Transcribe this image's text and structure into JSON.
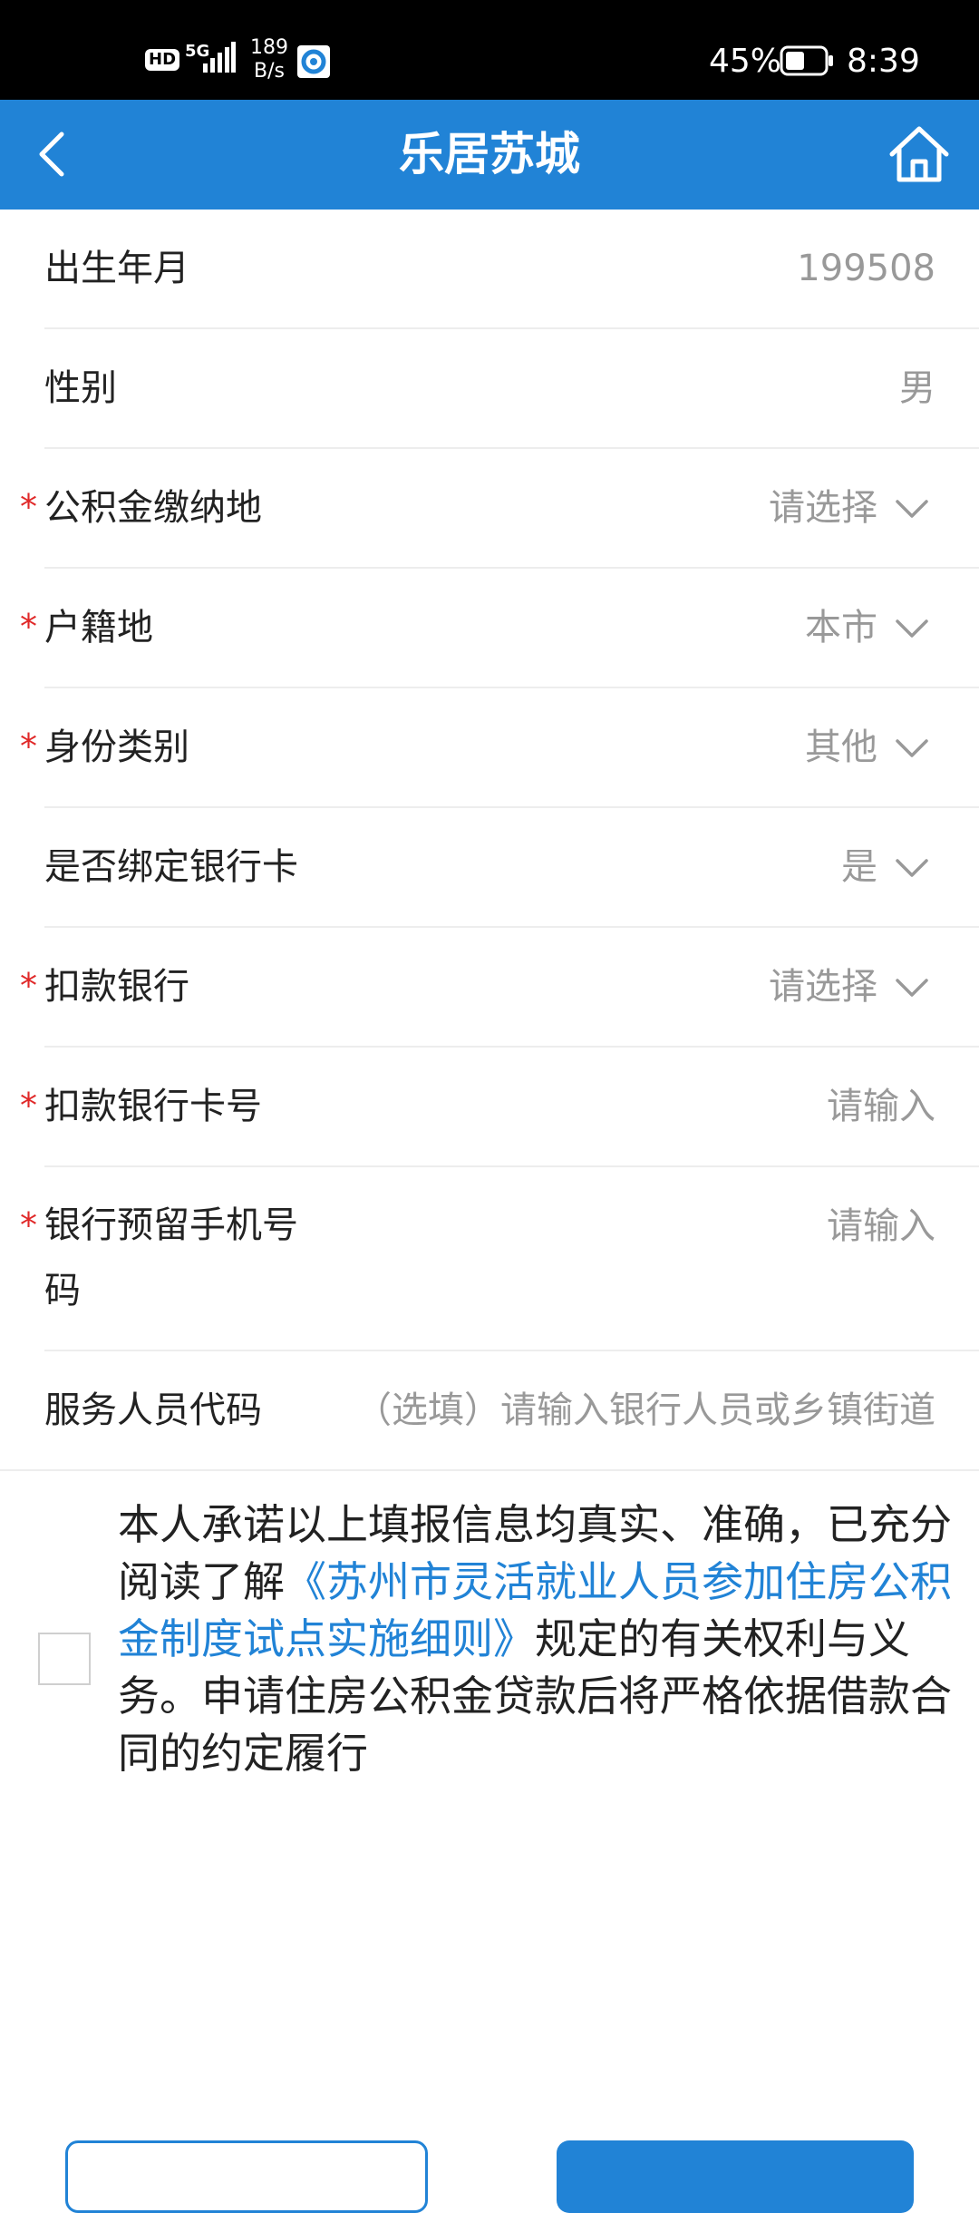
{
  "status_bar": {
    "hd": "HD",
    "network": "5G",
    "rate_value": "189",
    "rate_unit": "B/s",
    "battery_pct": "45%",
    "time": "8:39"
  },
  "app_bar": {
    "title": "乐居苏城",
    "back_icon": "chevron-left-icon",
    "home_icon": "home-icon"
  },
  "form": {
    "rows": [
      {
        "label": "出生年月",
        "value": "199508",
        "required": false,
        "type": "text"
      },
      {
        "label": "性别",
        "value": "男",
        "required": false,
        "type": "text"
      },
      {
        "label": "公积金缴纳地",
        "value": "请选择",
        "required": true,
        "type": "select"
      },
      {
        "label": "户籍地",
        "value": "本市",
        "required": true,
        "type": "select"
      },
      {
        "label": "身份类别",
        "value": "其他",
        "required": true,
        "type": "select"
      },
      {
        "label": "是否绑定银行卡",
        "value": "是",
        "required": false,
        "type": "select"
      },
      {
        "label": "扣款银行",
        "value": "请选择",
        "required": true,
        "type": "select"
      },
      {
        "label": "扣款银行卡号",
        "placeholder": "请输入",
        "required": true,
        "type": "input"
      },
      {
        "label": "银行预留手机号码",
        "placeholder": "请输入",
        "required": true,
        "type": "input"
      },
      {
        "label": "服务人员代码",
        "placeholder": "（选填）请输入银行人员或乡镇街道",
        "required": false,
        "type": "input"
      }
    ]
  },
  "consent": {
    "text_before": "本人承诺以上填报信息均真实、准确，已充分阅读了解",
    "link": "《苏州市灵活就业人员参加住房公积金制度试点实施细则》",
    "text_after": "规定的有关权利与义务。申请住房公积金贷款后将严格依据借款合同的约定履行",
    "checked": false
  },
  "colors": {
    "primary": "#2183d6",
    "required": "#e02828",
    "muted": "#999999"
  }
}
